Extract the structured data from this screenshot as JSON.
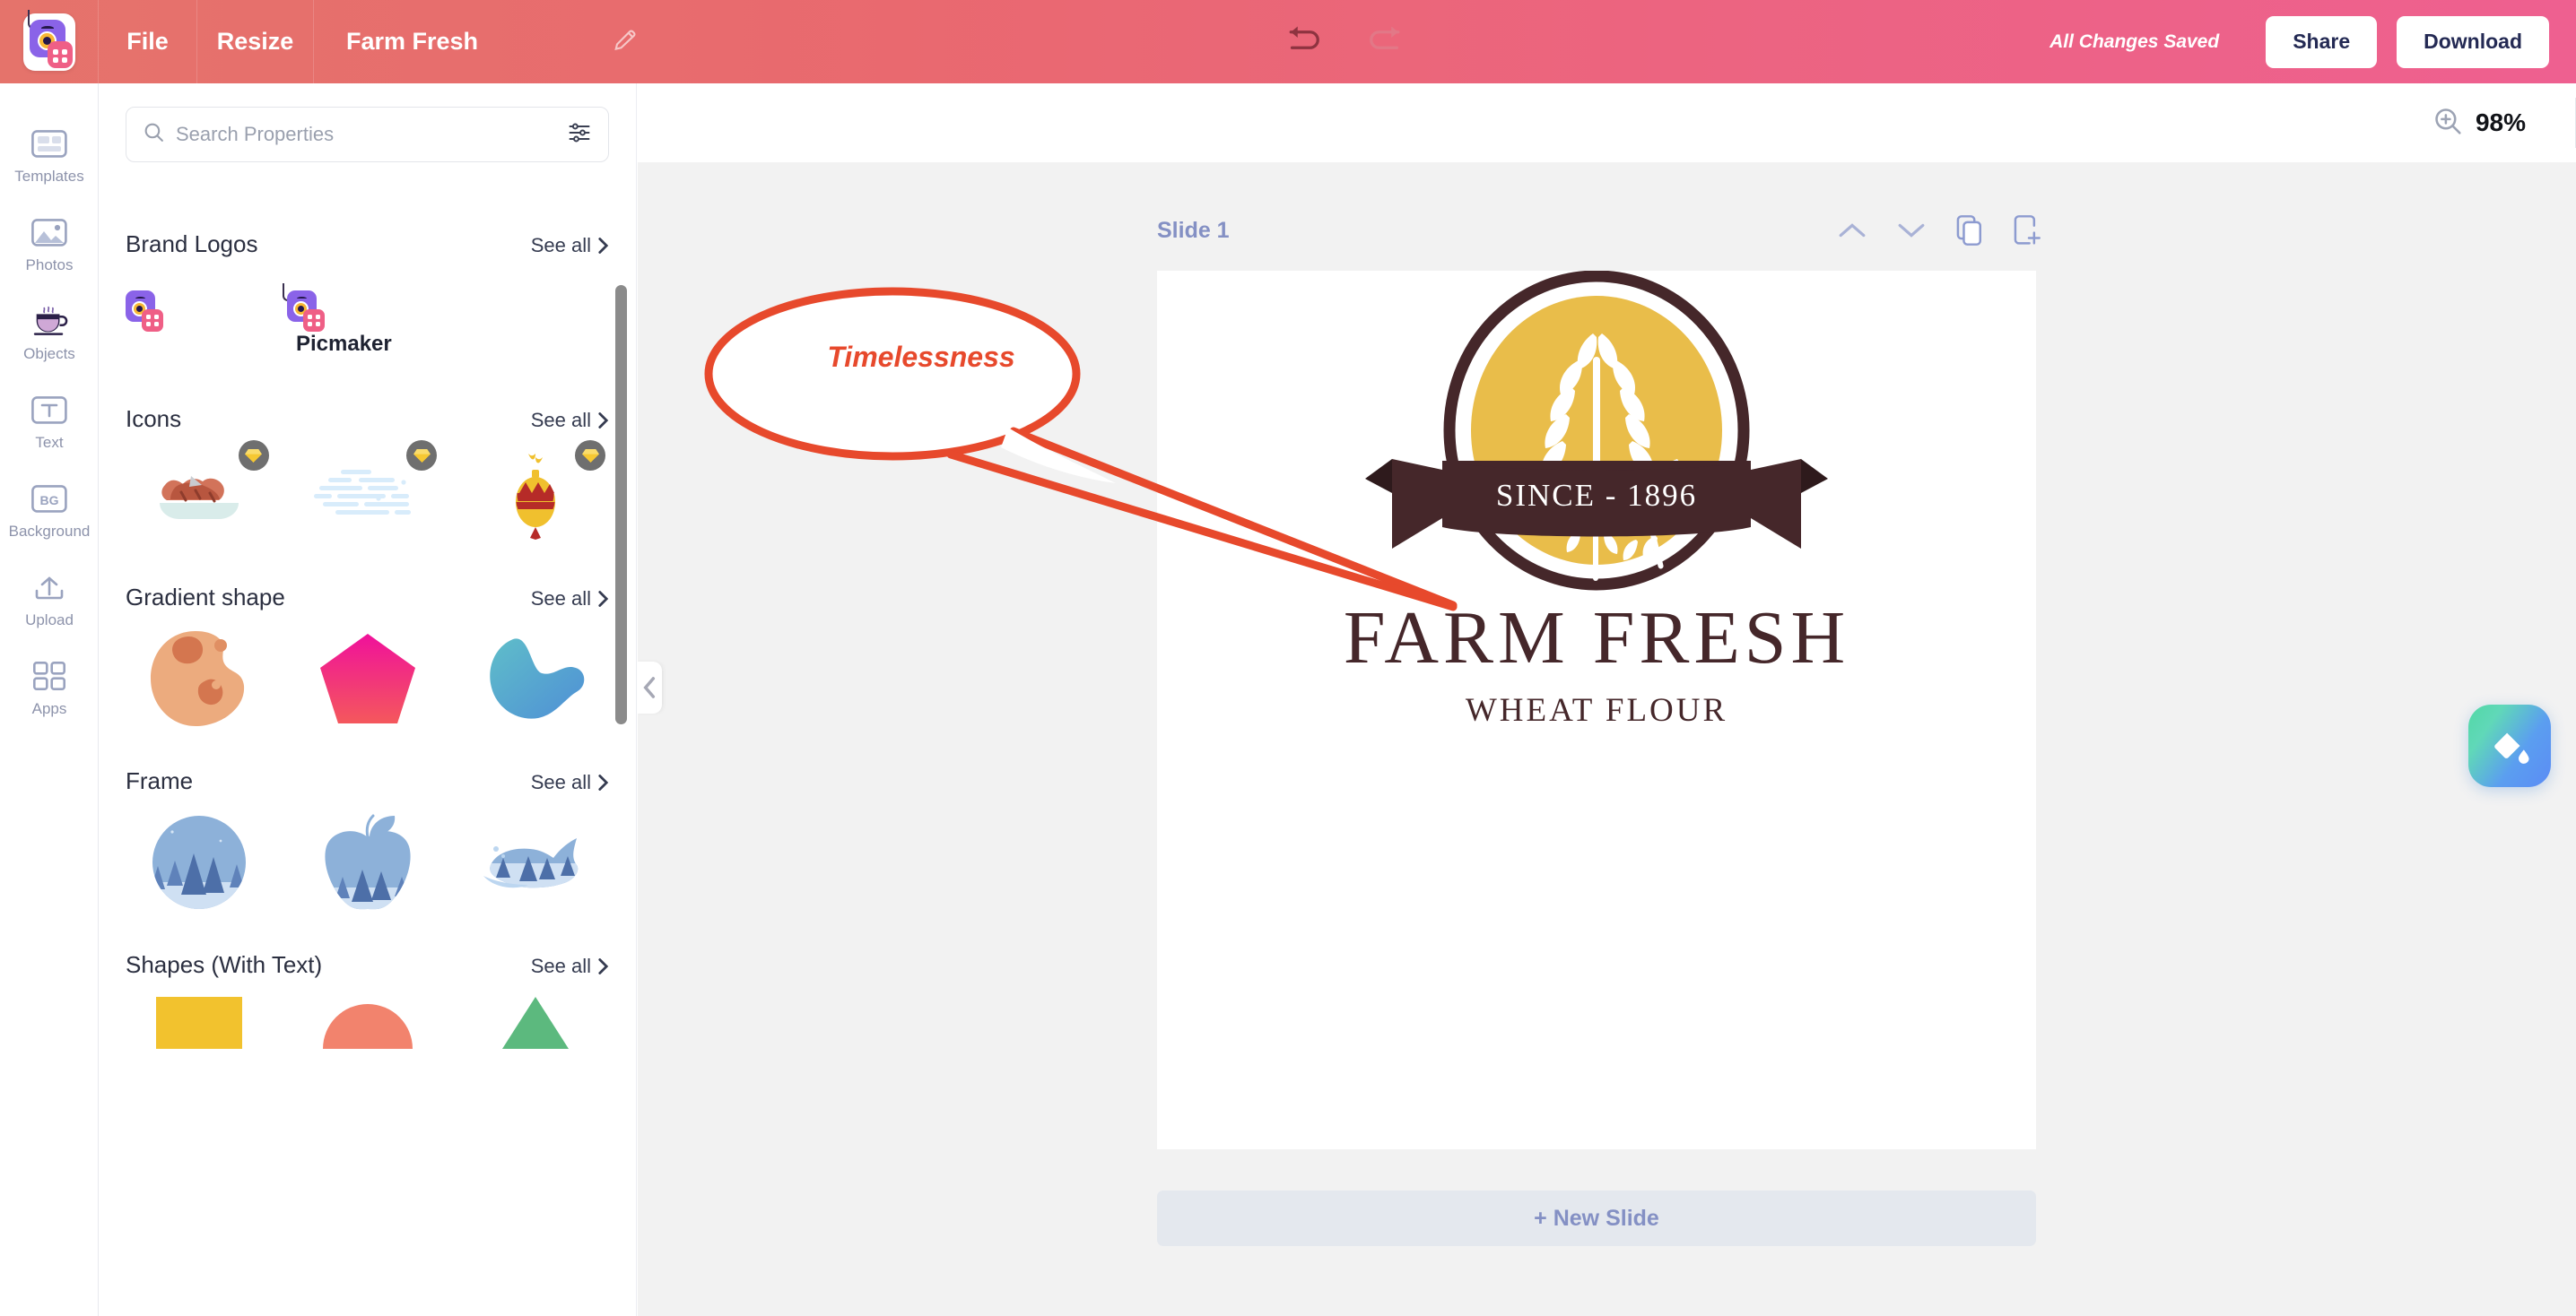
{
  "header": {
    "logo_icon": "picmaker-logo-icon",
    "menu": [
      {
        "label": "File",
        "name": "file-menu"
      },
      {
        "label": "Resize",
        "name": "resize-menu"
      }
    ],
    "project_title": "Farm Fresh",
    "edit_icon": "pencil-icon",
    "undo_icon": "undo-icon",
    "redo_icon": "redo-icon",
    "save_status": "All Changes Saved",
    "share_label": "Share",
    "download_label": "Download"
  },
  "rail": {
    "items": [
      {
        "label": "Templates",
        "icon": "templates-icon",
        "active": false
      },
      {
        "label": "Photos",
        "icon": "photos-icon",
        "active": false
      },
      {
        "label": "Objects",
        "icon": "objects-coffee-cup-icon",
        "active": true
      },
      {
        "label": "Text",
        "icon": "text-icon",
        "active": false
      },
      {
        "label": "Background",
        "icon": "background-icon",
        "active": false
      },
      {
        "label": "Upload",
        "icon": "upload-icon",
        "active": false
      },
      {
        "label": "Apps",
        "icon": "apps-grid-icon",
        "active": false
      }
    ]
  },
  "panel": {
    "search": {
      "placeholder": "Search Properties",
      "value": "",
      "search_icon": "search-icon",
      "filter_icon": "filter-sliders-icon"
    },
    "see_all_label": "See all",
    "sections": [
      {
        "title": "Brand Logos",
        "name": "section-brand-logos",
        "items": [
          {
            "name": "brand-logo-mark",
            "label": ""
          },
          {
            "name": "brand-logo-wordmark",
            "label": "Picmaker"
          }
        ]
      },
      {
        "title": "Icons",
        "name": "section-icons",
        "items": [
          {
            "name": "icon-roast-dish",
            "premium": true
          },
          {
            "name": "icon-cloud",
            "premium": true
          },
          {
            "name": "icon-ornament",
            "premium": true
          }
        ]
      },
      {
        "title": "Gradient shape",
        "name": "section-gradient-shape",
        "items": [
          {
            "name": "gradient-blob-orange",
            "premium": false
          },
          {
            "name": "gradient-pentagon-pink",
            "premium": false
          },
          {
            "name": "gradient-blob-blue",
            "premium": false
          }
        ]
      },
      {
        "title": "Frame",
        "name": "section-frame",
        "items": [
          {
            "name": "frame-circle-forest",
            "premium": false
          },
          {
            "name": "frame-apple-forest",
            "premium": false
          },
          {
            "name": "frame-whale-forest",
            "premium": false
          }
        ]
      },
      {
        "title": "Shapes (With Text)",
        "name": "section-shapes-with-text",
        "items": [
          {
            "name": "shape-rectangle-yellow",
            "premium": false
          },
          {
            "name": "shape-semicircle-coral",
            "premium": false
          },
          {
            "name": "shape-triangle-green",
            "premium": false
          }
        ]
      }
    ],
    "collapse_icon": "chevron-left-icon"
  },
  "stage": {
    "zoom": {
      "icon": "zoom-in-icon",
      "value": "98%"
    },
    "slide": {
      "label": "Slide 1",
      "tools": [
        {
          "name": "move-slide-up-button",
          "icon": "chevron-up-icon"
        },
        {
          "name": "move-slide-down-button",
          "icon": "chevron-down-icon"
        },
        {
          "name": "duplicate-slide-button",
          "icon": "duplicate-icon"
        },
        {
          "name": "add-slide-button",
          "icon": "add-page-icon"
        }
      ]
    },
    "new_slide_label": "+ New Slide",
    "fab_icon": "paint-bucket-icon"
  },
  "artwork": {
    "annotation_text": "Timelessness",
    "annotation_color": "#e7492c",
    "badge_text": "SINCE - 1896",
    "brand_title": "FARM FRESH",
    "brand_subtitle": "WHEAT FLOUR",
    "colors": {
      "badge_gold": "#e9bd4a",
      "brand_brown": "#45272a"
    }
  }
}
